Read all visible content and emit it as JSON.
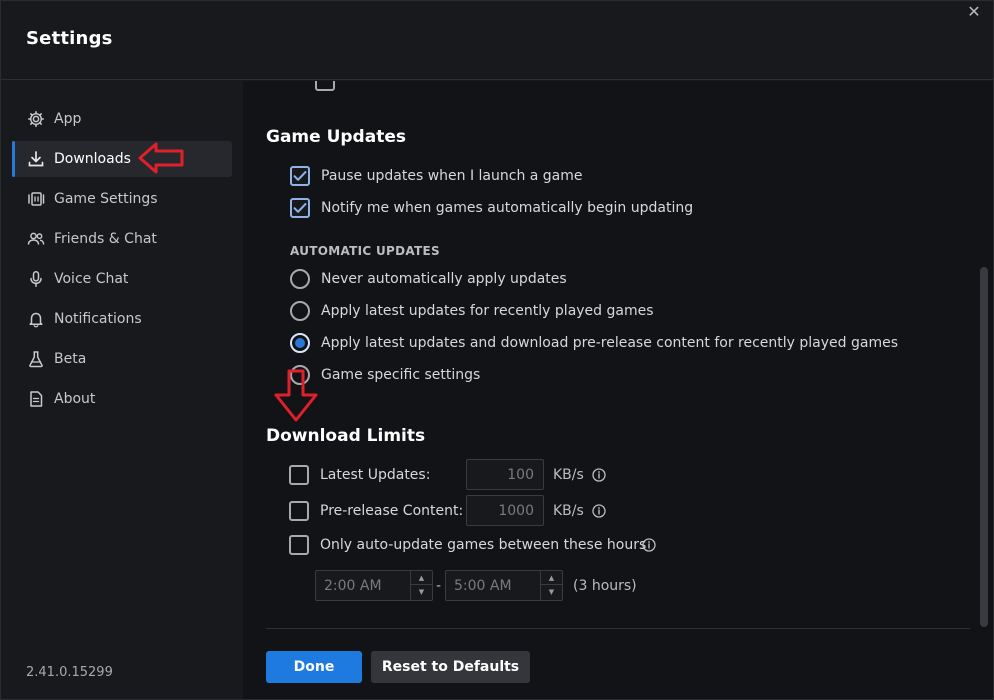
{
  "window": {
    "title": "Settings",
    "close_glyph": "✕"
  },
  "sidebar": {
    "items": [
      {
        "label": "App",
        "icon": "gear-icon"
      },
      {
        "label": "Downloads",
        "icon": "download-icon"
      },
      {
        "label": "Game Settings",
        "icon": "game-settings-icon"
      },
      {
        "label": "Friends & Chat",
        "icon": "friends-icon"
      },
      {
        "label": "Voice Chat",
        "icon": "microphone-icon"
      },
      {
        "label": "Notifications",
        "icon": "bell-icon"
      },
      {
        "label": "Beta",
        "icon": "flask-icon"
      },
      {
        "label": "About",
        "icon": "document-icon"
      }
    ],
    "active": "Downloads",
    "version": "2.41.0.15299"
  },
  "game_updates": {
    "title": "Game Updates",
    "pause_label": "Pause updates when I launch a game",
    "pause_checked": true,
    "notify_label": "Notify me when games automatically begin updating",
    "notify_checked": true,
    "auto_heading": "AUTOMATIC UPDATES",
    "options": [
      "Never automatically apply updates",
      "Apply latest updates for recently played games",
      "Apply latest updates and download pre-release content for recently played games",
      "Game specific settings"
    ],
    "selected_option": "Apply latest updates and download pre-release content for recently played games"
  },
  "download_limits": {
    "title": "Download Limits",
    "latest_label": "Latest Updates:",
    "latest_value": "100",
    "prerelease_label": "Pre-release Content:",
    "prerelease_value": "1000",
    "unit": "KB/s",
    "hours_label": "Only auto-update games between these hours",
    "start_time": "2:00 AM",
    "end_time": "5:00 AM",
    "dash": "-",
    "duration": "(3 hours)"
  },
  "buttons": {
    "done": "Done",
    "reset": "Reset to Defaults"
  },
  "colors": {
    "accent": "#1f7ae0",
    "annotation": "#e0202a"
  }
}
